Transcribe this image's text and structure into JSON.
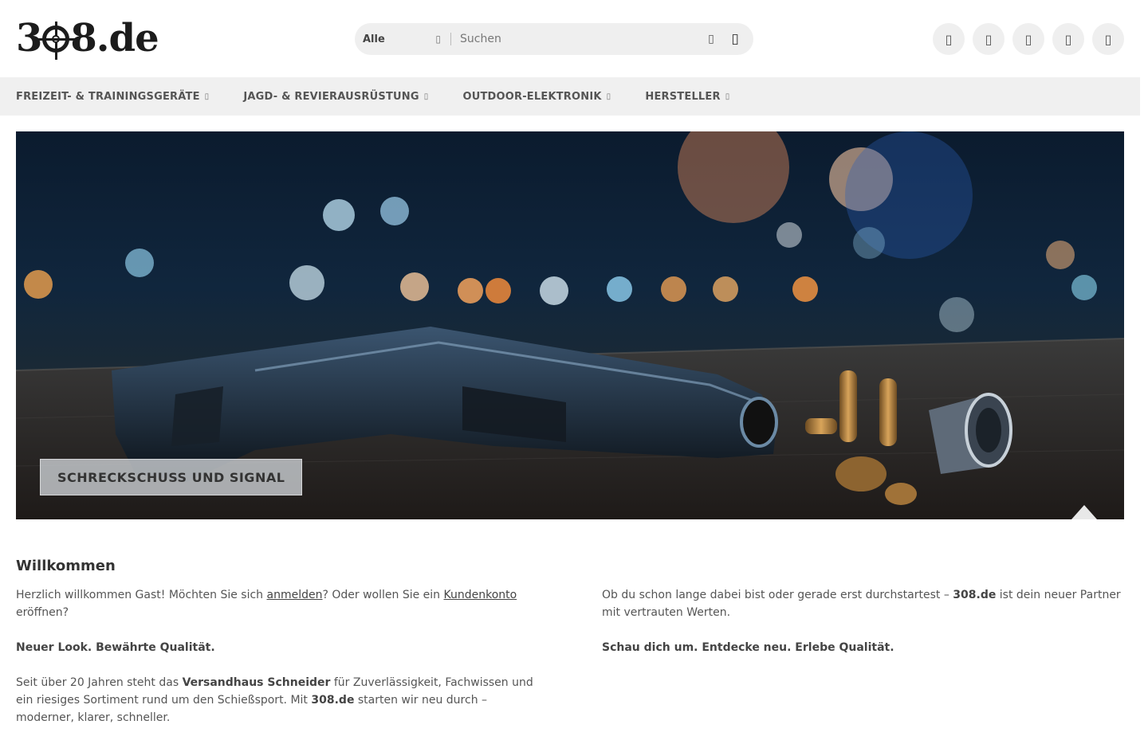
{
  "header": {
    "logo_text_a": "3",
    "logo_text_b": "8.de",
    "search": {
      "category": "Alle",
      "placeholder": "Suchen"
    },
    "actions": [
      "user-icon",
      "heart-icon",
      "compare-icon",
      "info-icon",
      "cart-icon"
    ]
  },
  "nav": {
    "items": [
      {
        "label": "FREIZEIT- & TRAININGSGERÄTE"
      },
      {
        "label": "JAGD- & REVIERAUSRÜSTUNG"
      },
      {
        "label": "OUTDOOR-ELEKTRONIK"
      },
      {
        "label": "HERSTELLER"
      }
    ]
  },
  "hero": {
    "label": "SCHRECKSCHUSS UND SIGNAL"
  },
  "welcome": {
    "title": "Willkommen",
    "left": {
      "greeting_pre": "Herzlich willkommen Gast! Möchten Sie sich ",
      "login_link": "anmelden",
      "greeting_mid": "? Oder wollen Sie ein ",
      "account_link": "Kundenkonto",
      "greeting_post": " eröffnen?",
      "headline": "Neuer Look. Bewährte Qualität.",
      "para_a": "Seit über 20 Jahren steht das ",
      "para_b": "Versandhaus Schneider",
      "para_c": " für Zuverlässigkeit, Fachwissen und ein riesiges Sortiment rund um den Schießsport. Mit ",
      "para_d": "308.de",
      "para_e": " starten wir neu durch – moderner, klarer, schneller."
    },
    "right": {
      "para_a": "Ob du schon lange dabei bist oder gerade erst durchstartest – ",
      "para_b": "308.de",
      "para_c": " ist dein neuer Partner mit vertrauten Werten.",
      "tagline": "Schau dich um. Entdecke neu. Erlebe Qualität."
    }
  }
}
